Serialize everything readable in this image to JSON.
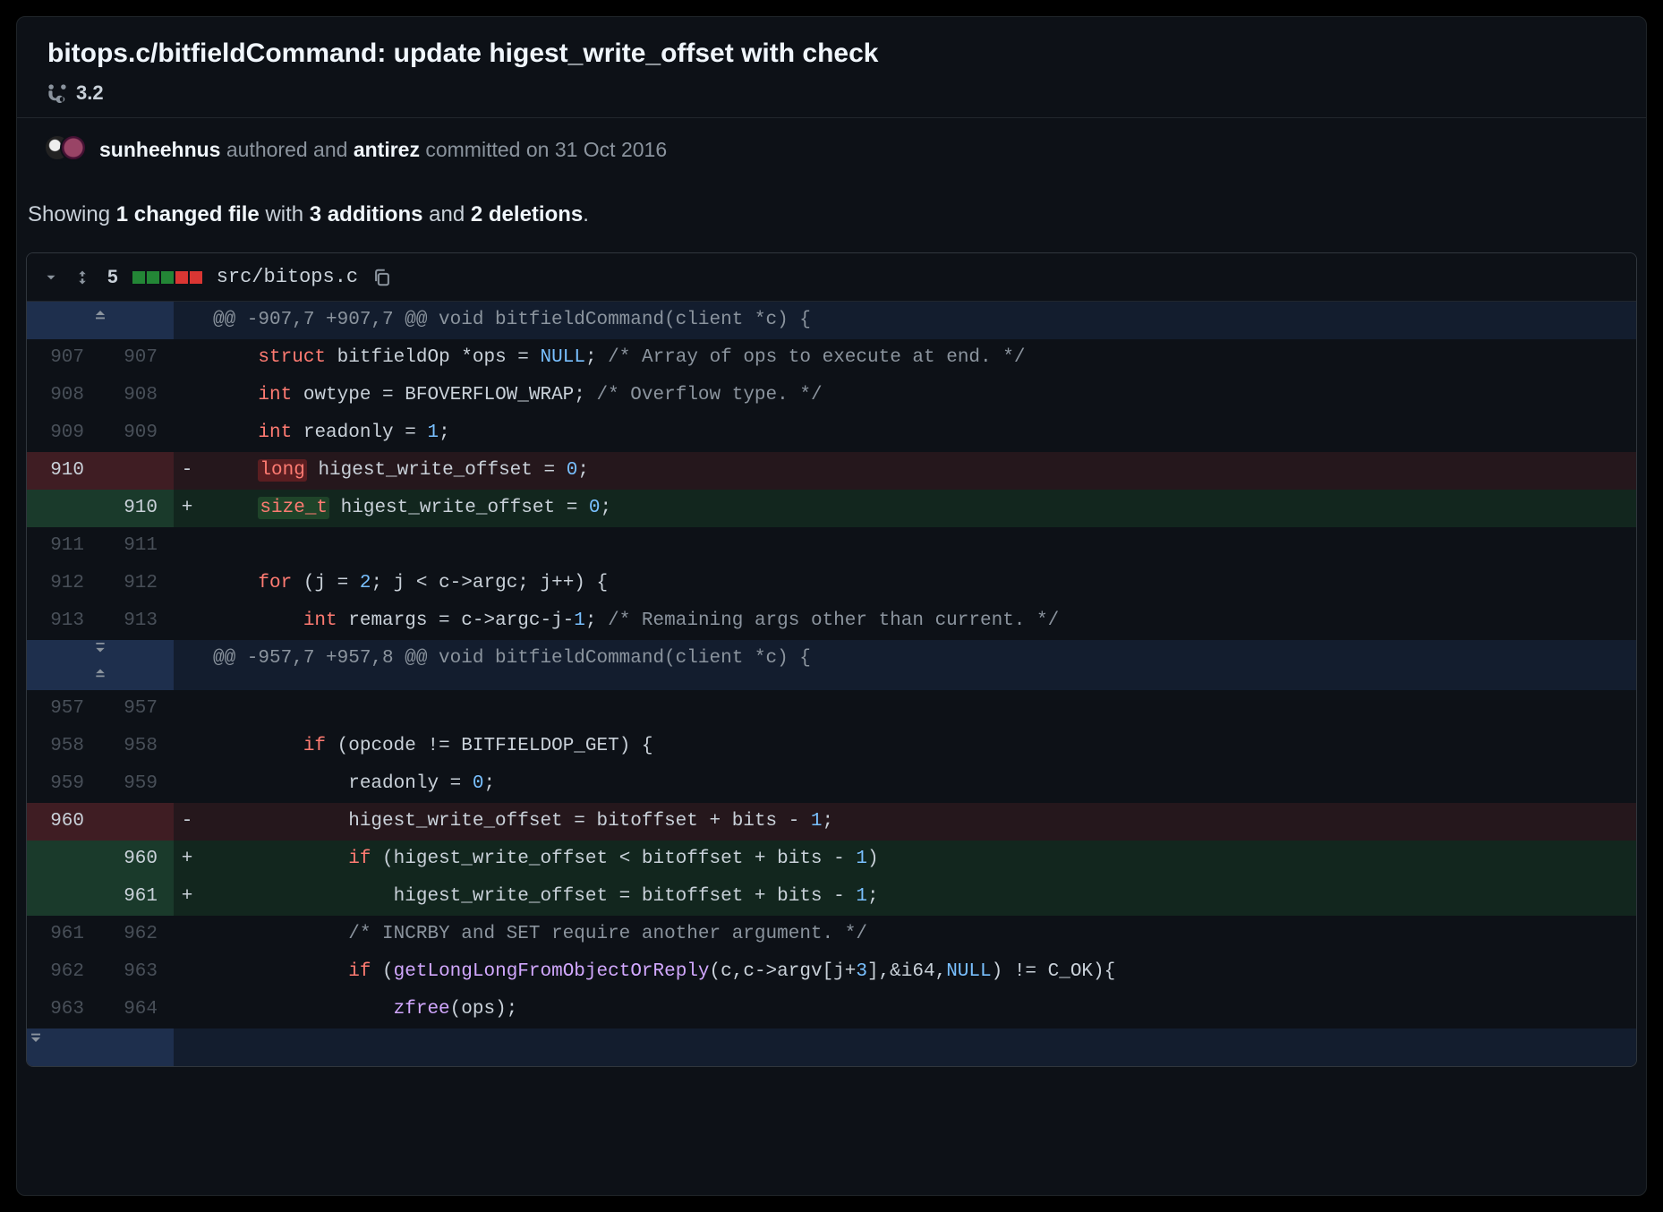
{
  "commit": {
    "title": "bitops.c/bitfieldCommand: update higest_write_offset with check",
    "branch": "3.2",
    "author1": "sunheehnus",
    "authored_word": "authored and",
    "author2": "antirez",
    "committed_word": "committed",
    "date": "on 31 Oct 2016"
  },
  "summary": {
    "prefix": "Showing ",
    "files_count": "1 changed file",
    "mid1": " with ",
    "additions": "3 additions",
    "mid2": " and ",
    "deletions": "2 deletions",
    "suffix": "."
  },
  "file": {
    "changes_count": "5",
    "path": "src/bitops.c",
    "diffstat": {
      "green": 3,
      "red": 2
    }
  },
  "diff": {
    "hunk1": {
      "header": "@@ -907,7 +907,7 @@ void bitfieldCommand(client *c) {",
      "lines": [
        {
          "old": "907",
          "new": "907",
          "type": "ctx",
          "html": "    <span class='k'>struct</span> <span class='id'>bitfieldOp</span> *ops = <span class='n'>NULL</span>; <span class='c'>/* Array of ops to execute at end. */</span>"
        },
        {
          "old": "908",
          "new": "908",
          "type": "ctx",
          "html": "    <span class='t'>int</span> owtype = BFOVERFLOW_WRAP; <span class='c'>/* Overflow type. */</span>"
        },
        {
          "old": "909",
          "new": "909",
          "type": "ctx",
          "html": "    <span class='t'>int</span> readonly = <span class='n'>1</span>;"
        },
        {
          "old": "910",
          "new": "",
          "type": "del",
          "html": "    <span class='hl-del'><span class='t'>long</span></span> higest_write_offset = <span class='n'>0</span>;"
        },
        {
          "old": "",
          "new": "910",
          "type": "add",
          "html": "    <span class='hl-add'><span class='t'>size_t</span></span> higest_write_offset = <span class='n'>0</span>;"
        },
        {
          "old": "911",
          "new": "911",
          "type": "ctx",
          "html": ""
        },
        {
          "old": "912",
          "new": "912",
          "type": "ctx",
          "html": "    <span class='k'>for</span> (j = <span class='n'>2</span>; j &lt; c-&gt;argc; j++) {"
        },
        {
          "old": "913",
          "new": "913",
          "type": "ctx",
          "html": "        <span class='t'>int</span> remargs = c-&gt;argc-j-<span class='n'>1</span>; <span class='c'>/* Remaining args other than current. */</span>"
        }
      ]
    },
    "hunk2": {
      "header": "@@ -957,7 +957,8 @@ void bitfieldCommand(client *c) {",
      "lines": [
        {
          "old": "957",
          "new": "957",
          "type": "ctx",
          "html": ""
        },
        {
          "old": "958",
          "new": "958",
          "type": "ctx",
          "html": "        <span class='k'>if</span> (opcode != BITFIELDOP_GET) {"
        },
        {
          "old": "959",
          "new": "959",
          "type": "ctx",
          "html": "            readonly = <span class='n'>0</span>;"
        },
        {
          "old": "960",
          "new": "",
          "type": "del",
          "html": "            higest_write_offset = bitoffset + bits - <span class='n'>1</span>;"
        },
        {
          "old": "",
          "new": "960",
          "type": "add",
          "html": "            <span class='k'>if</span> (higest_write_offset &lt; bitoffset + bits - <span class='n'>1</span>)"
        },
        {
          "old": "",
          "new": "961",
          "type": "add",
          "html": "                higest_write_offset = bitoffset + bits - <span class='n'>1</span>;"
        },
        {
          "old": "961",
          "new": "962",
          "type": "ctx",
          "html": "            <span class='c'>/* INCRBY and SET require another argument. */</span>"
        },
        {
          "old": "962",
          "new": "963",
          "type": "ctx",
          "html": "            <span class='k'>if</span> (<span class='f'>getLongLongFromObjectOrReply</span>(c,c-&gt;argv[j+<span class='n'>3</span>],&amp;i64,<span class='n'>NULL</span>) != C_OK){"
        },
        {
          "old": "963",
          "new": "964",
          "type": "ctx",
          "html": "                <span class='f'>zfree</span>(ops);"
        }
      ]
    }
  }
}
